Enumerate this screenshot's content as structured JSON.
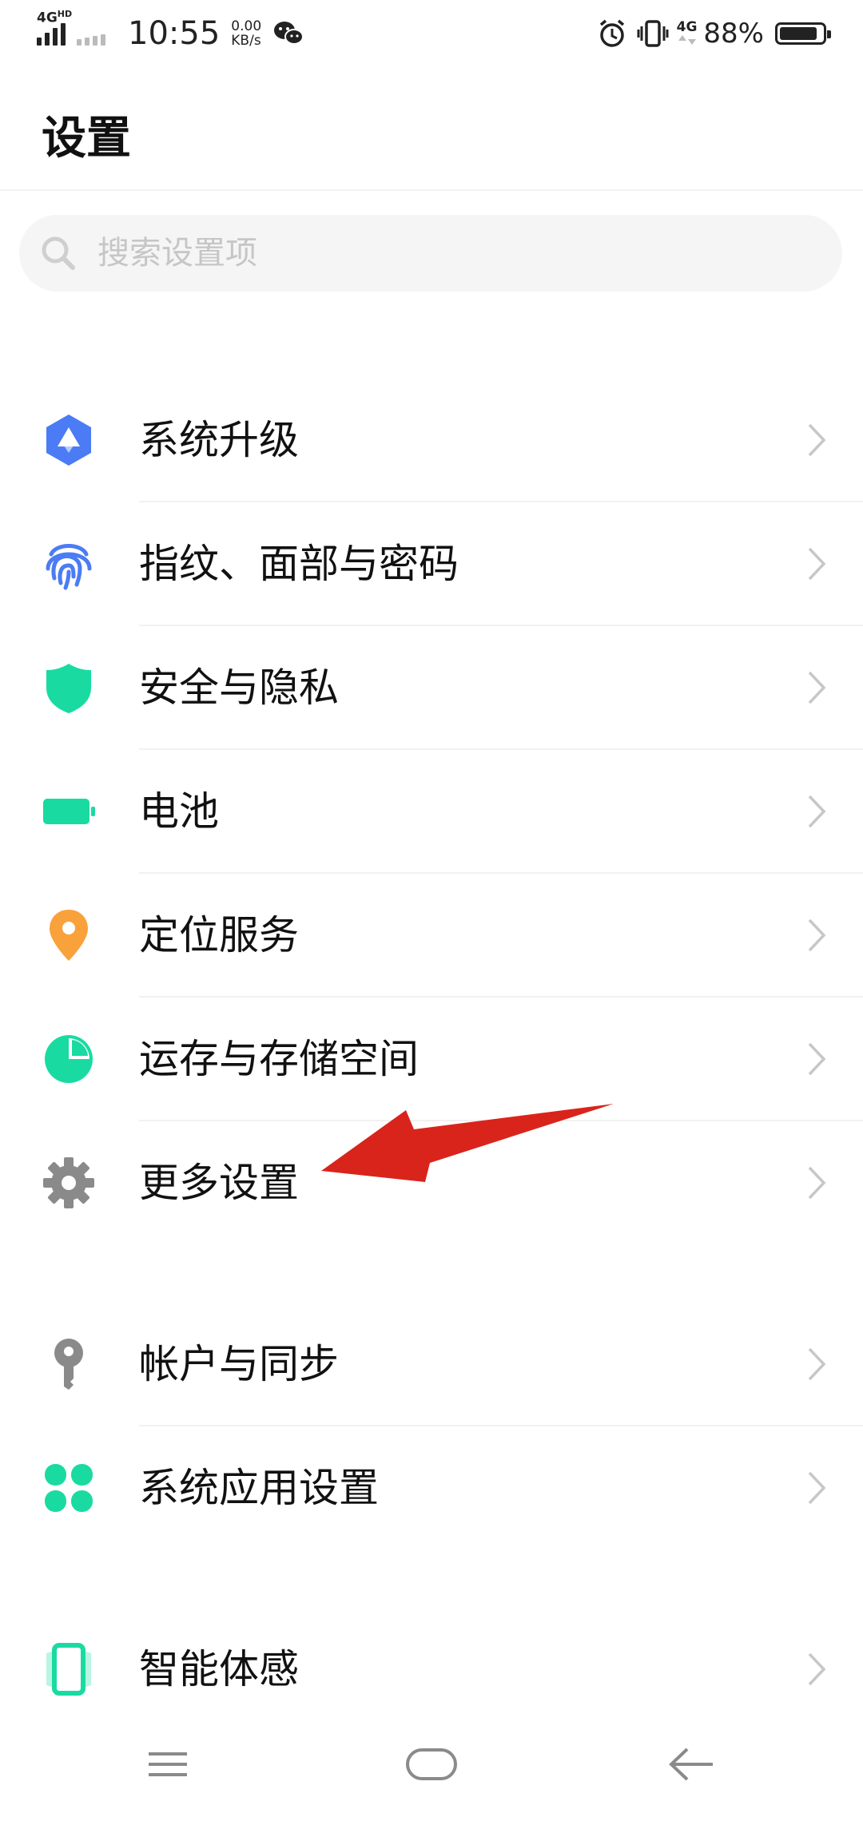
{
  "status_bar": {
    "network_left": "4G",
    "network_left_sup": "HD",
    "time": "10:55",
    "speed_value": "0.00",
    "speed_unit": "KB/s",
    "network_right": "4G",
    "battery_percent": "88%",
    "battery_level": 0.88
  },
  "page": {
    "title": "设置"
  },
  "search": {
    "placeholder": "搜索设置项"
  },
  "settings_items": [
    {
      "label": "系统升级",
      "icon": "system-update-icon",
      "color": "#4b7cf5"
    },
    {
      "label": "指纹、面部与密码",
      "icon": "fingerprint-icon",
      "color": "#4b7cf5"
    },
    {
      "label": "安全与隐私",
      "icon": "shield-icon",
      "color": "#19dba2"
    },
    {
      "label": "电池",
      "icon": "battery-icon",
      "color": "#19dba2"
    },
    {
      "label": "定位服务",
      "icon": "location-pin-icon",
      "color": "#f9a13b"
    },
    {
      "label": "运存与存储空间",
      "icon": "pie-chart-icon",
      "color": "#19dba2"
    },
    {
      "label": "更多设置",
      "icon": "gear-icon",
      "color": "#888888"
    },
    {
      "label": "帐户与同步",
      "icon": "key-icon",
      "color": "#888888"
    },
    {
      "label": "系统应用设置",
      "icon": "apps-grid-icon",
      "color": "#19dba2"
    },
    {
      "label": "智能体感",
      "icon": "phone-motion-icon",
      "color": "#19dba2"
    }
  ],
  "annotation": {
    "arrow_color": "#d9241c"
  }
}
